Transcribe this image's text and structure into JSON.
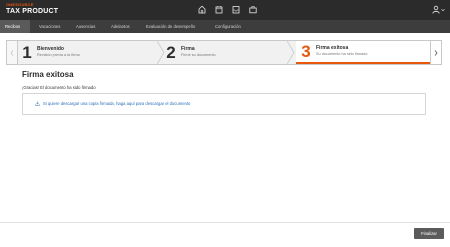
{
  "header": {
    "brand_top": "ONESOURCE",
    "brand_main": "TAX PRODUCT",
    "icons": [
      "home-icon",
      "calendar-icon",
      "inbox-icon",
      "briefcase-icon"
    ],
    "user_icon": "user-icon"
  },
  "nav": {
    "items": [
      {
        "label": "Recibos",
        "active": true
      },
      {
        "label": "Vacaciones",
        "active": false
      },
      {
        "label": "Ausencias",
        "active": false
      },
      {
        "label": "Adelantos",
        "active": false
      },
      {
        "label": "Evaluación de desempeño",
        "active": false
      },
      {
        "label": "Configuración",
        "active": false
      }
    ]
  },
  "stepper": {
    "steps": [
      {
        "number": "1",
        "title": "Bienvenido",
        "description": "Revisión previa a la firma",
        "active": false
      },
      {
        "number": "2",
        "title": "Firma",
        "description": "Firme su documento",
        "active": false
      },
      {
        "number": "3",
        "title": "Firma exitosa",
        "description": "Su documento ha sido firmado",
        "active": true
      }
    ]
  },
  "content": {
    "title": "Firma exitosa",
    "message": "¡Gracias! El documento ha sido firmado",
    "download_link": "Si quiere descargar una copia firmada, haga aquí para descargar el documento"
  },
  "footer": {
    "finish_label": "Finalizar"
  },
  "colors": {
    "accent": "#e8580c",
    "link": "#2a6ebb",
    "header_bg": "#2b2b2b",
    "nav_bg": "#3d3d3d"
  }
}
